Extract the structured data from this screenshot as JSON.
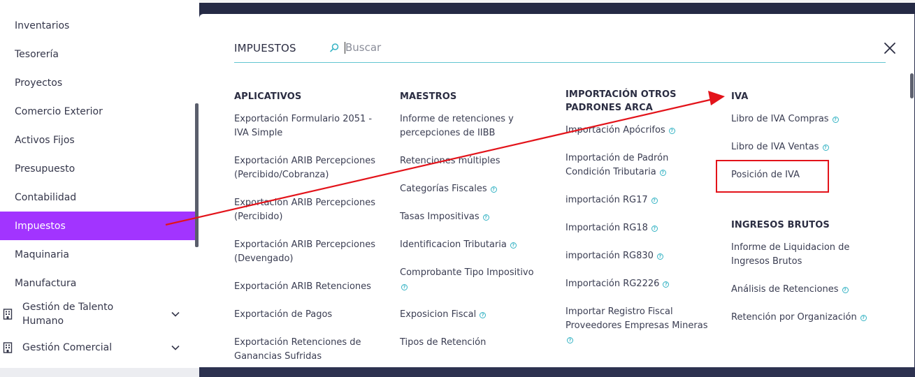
{
  "sidebar": {
    "items": [
      {
        "label": "Inventarios"
      },
      {
        "label": "Tesorería"
      },
      {
        "label": "Proyectos"
      },
      {
        "label": "Comercio Exterior"
      },
      {
        "label": "Activos Fijos"
      },
      {
        "label": "Presupuesto"
      },
      {
        "label": "Contabilidad"
      },
      {
        "label": "Impuestos",
        "active": true
      },
      {
        "label": "Maquinaria"
      },
      {
        "label": "Manufactura"
      }
    ],
    "groups": [
      {
        "label": "Gestión de Talento Humano",
        "icon": "building-icon",
        "chevron": "chevron-down-icon"
      },
      {
        "label": "Gestión Comercial",
        "icon": "building-icon",
        "chevron": "chevron-down-icon"
      }
    ],
    "active_color": "#a234ff"
  },
  "panel": {
    "title": "IMPUESTOS",
    "search": {
      "placeholder": "Buscar",
      "value": "",
      "icon": "search-icon"
    },
    "close_icon": "close-icon",
    "help_glyph": "?",
    "accent_color": "#35b3c4",
    "columns": [
      {
        "heading": "APLICATIVOS",
        "links": [
          {
            "label": "Exportación Formulario 2051 - IVA Simple",
            "help": false
          },
          {
            "label": "Exportación ARIB Percepciones (Percibido/Cobranza)",
            "help": false
          },
          {
            "label": "Exportación ARIB Percepciones (Percibido)",
            "help": false
          },
          {
            "label": "Exportación ARIB Percepciones (Devengado)",
            "help": false
          },
          {
            "label": "Exportación ARIB Retenciones",
            "help": false
          },
          {
            "label": "Exportación de Pagos",
            "help": false
          },
          {
            "label": "Exportación Retenciones de Ganancias Sufridas",
            "help": false
          }
        ]
      },
      {
        "heading": "MAESTROS",
        "links": [
          {
            "label": "Informe de retenciones y percepciones de IIBB",
            "help": false
          },
          {
            "label": "Retenciones múltiples",
            "help": false
          },
          {
            "label": "Categorías Fiscales",
            "help": true
          },
          {
            "label": "Tasas Impositivas",
            "help": true
          },
          {
            "label": "Identificacion Tributaria",
            "help": true
          },
          {
            "label": "Comprobante Tipo Impositivo",
            "help": true
          },
          {
            "label": "Exposicion Fiscal",
            "help": true
          },
          {
            "label": "Tipos de Retención",
            "help": false
          }
        ]
      },
      {
        "heading": "IMPORTACIÓN OTROS PADRONES ARCA",
        "links": [
          {
            "label": "Importación Apócrifos",
            "help": true
          },
          {
            "label": "Importación de Padrón Condición Tributaria",
            "help": true
          },
          {
            "label": "importación RG17",
            "help": true
          },
          {
            "label": "Importación RG18",
            "help": true
          },
          {
            "label": "importación RG830",
            "help": true
          },
          {
            "label": "Importación RG2226",
            "help": true
          },
          {
            "label": "Importar Registro Fiscal Proveedores Empresas Mineras",
            "help": true
          }
        ]
      },
      {
        "heading": "IVA",
        "links": [
          {
            "label": "Libro de IVA Compras",
            "help": true
          },
          {
            "label": "Libro de IVA Ventas",
            "help": true
          },
          {
            "label": "Posición de IVA",
            "help": false
          }
        ],
        "heading2": "INGRESOS BRUTOS",
        "links2": [
          {
            "label": "Informe de Liquidacion de Ingresos Brutos",
            "help": false
          },
          {
            "label": "Análisis de Retenciones",
            "help": true
          },
          {
            "label": "Retención por Organización",
            "help": true
          }
        ]
      }
    ]
  },
  "annotation": {
    "arrow_color": "#e3131a",
    "highlight": "Posición de IVA"
  }
}
